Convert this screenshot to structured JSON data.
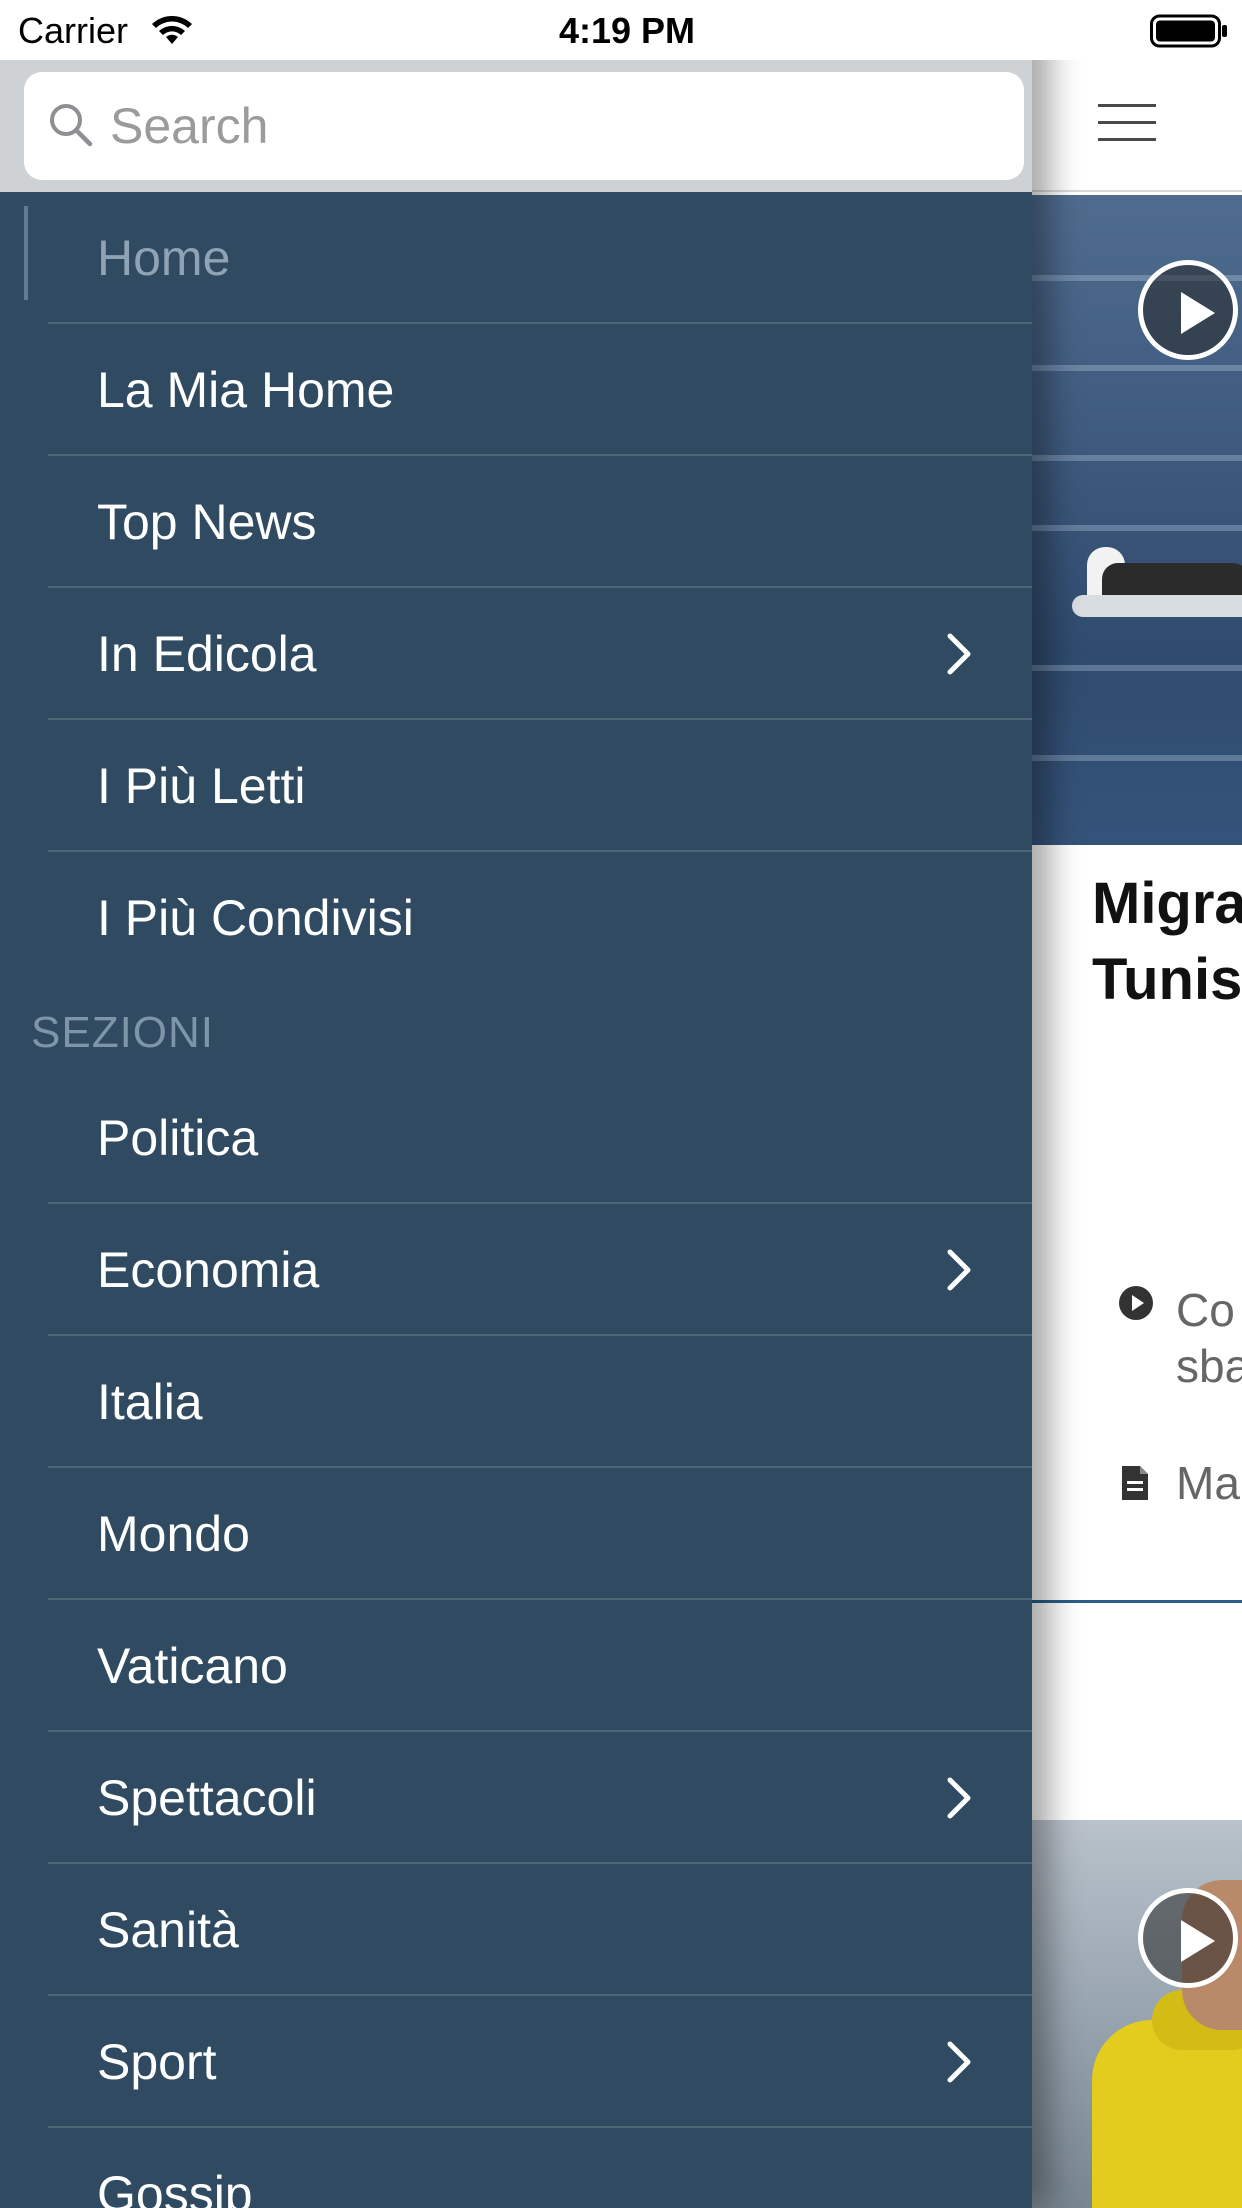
{
  "status_bar": {
    "carrier": "Carrier",
    "time": "4:19 PM"
  },
  "search": {
    "placeholder": "Search"
  },
  "drawer": {
    "top_items": [
      {
        "label": "Home",
        "active": true,
        "has_chevron": false
      },
      {
        "label": "La Mia Home",
        "active": false,
        "has_chevron": false
      },
      {
        "label": "Top News",
        "active": false,
        "has_chevron": false
      },
      {
        "label": "In Edicola",
        "active": false,
        "has_chevron": true
      },
      {
        "label": "I Più Letti",
        "active": false,
        "has_chevron": false
      },
      {
        "label": "I Più Condivisi",
        "active": false,
        "has_chevron": false
      }
    ],
    "section_title": "SEZIONI",
    "section_items": [
      {
        "label": "Politica",
        "has_chevron": false
      },
      {
        "label": "Economia",
        "has_chevron": true
      },
      {
        "label": "Italia",
        "has_chevron": false
      },
      {
        "label": "Mondo",
        "has_chevron": false
      },
      {
        "label": "Vaticano",
        "has_chevron": false
      },
      {
        "label": "Spettacoli",
        "has_chevron": true
      },
      {
        "label": "Sanità",
        "has_chevron": false
      },
      {
        "label": "Sport",
        "has_chevron": true
      },
      {
        "label": "Gossip",
        "has_chevron": false
      }
    ]
  },
  "content": {
    "headline_line1": "Migra",
    "headline_line2": "Tunis",
    "related_video_line1": "Co",
    "related_video_line2": "sba",
    "related_article": "Ma"
  },
  "colors": {
    "drawer_bg": "#2f4a61",
    "divider": "#4f6679",
    "section_header": "#7e94a7",
    "active_label": "#8fa3b5",
    "search_bar_bg": "#cfd2d4",
    "article_divider": "#2b5d8a"
  }
}
